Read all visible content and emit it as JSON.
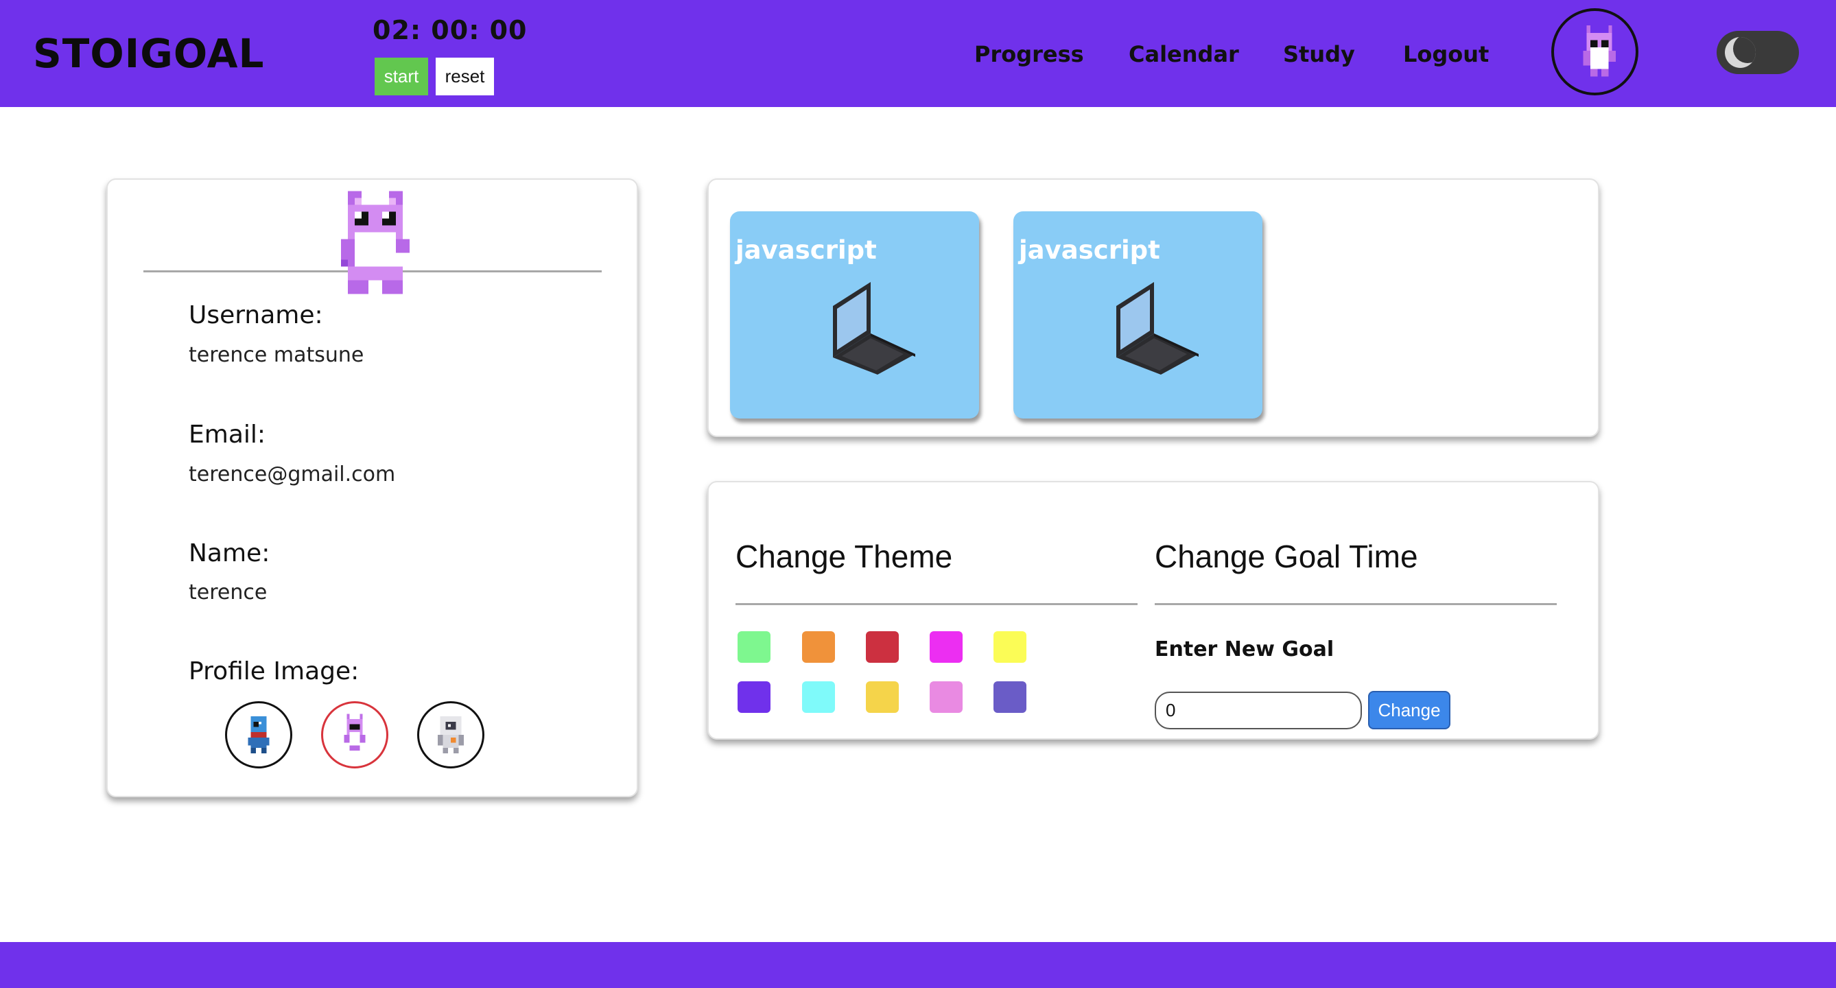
{
  "header": {
    "logo": "STOIGOAL",
    "timer": "02: 00: 00",
    "start_label": "start",
    "reset_label": "reset",
    "nav": [
      "Progress",
      "Calendar",
      "Study",
      "Logout"
    ],
    "avatar_icon": "purple-cat-avatar-icon",
    "toggle_icon": "moon-icon"
  },
  "profile": {
    "username_label": "Username:",
    "username_value": "terence matsune",
    "email_label": "Email:",
    "email_value": "terence@gmail.com",
    "name_label": "Name:",
    "name_value": "terence",
    "image_label": "Profile Image:",
    "image_options": [
      "blue-robot-avatar",
      "purple-cat-avatar",
      "astronaut-avatar"
    ],
    "selected_image": "purple-cat-avatar"
  },
  "projects": [
    {
      "title": "javascript",
      "icon": "laptop-icon"
    },
    {
      "title": "javascript",
      "icon": "laptop-icon"
    }
  ],
  "settings": {
    "theme_title": "Change Theme",
    "theme_colors": [
      "#7ef78f",
      "#f0923a",
      "#cc3040",
      "#ec2ef2",
      "#fbfc56",
      "#7031eb",
      "#7ffafa",
      "#f5d44a",
      "#e98ae2",
      "#6a5cc7"
    ],
    "goal_title": "Change Goal Time",
    "goal_label": "Enter New Goal",
    "goal_value": "0",
    "change_label": "Change"
  },
  "colors": {
    "brand": "#7031eb",
    "start": "#62c74f",
    "change": "#3c87ea",
    "tile": "#89ccf6"
  }
}
